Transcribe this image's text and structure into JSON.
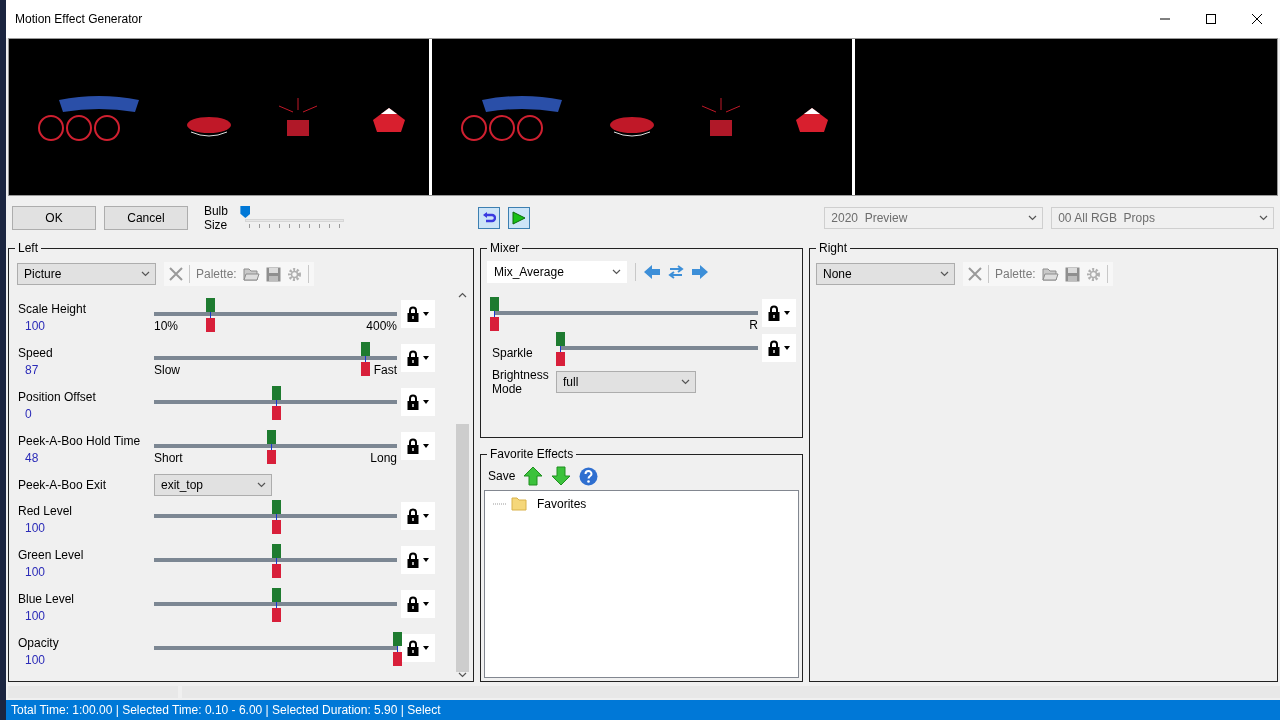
{
  "window": {
    "title": "Motion Effect Generator"
  },
  "preview": {
    "frames": [
      {
        "kind": "props"
      },
      {
        "kind": "props"
      },
      {
        "kind": "empty"
      }
    ]
  },
  "toolbar": {
    "ok": "OK",
    "cancel": "Cancel",
    "bulb_size": {
      "label": "Bulb Size",
      "level": 0
    },
    "preview_dropdown": {
      "value": "2020  Preview",
      "disabled": true
    },
    "props_dropdown": {
      "value": "00 All RGB  Props",
      "disabled": true
    }
  },
  "left": {
    "title": "Left",
    "effect": "Picture",
    "palette_label": "Palette:",
    "rows": [
      {
        "kind": "slider",
        "label": "Scale Height",
        "value": "100",
        "level": 0.23,
        "min_label": "10%",
        "max_label": "400%"
      },
      {
        "kind": "slider",
        "label": "Speed",
        "value": "87",
        "level": 0.87,
        "min_label": "Slow",
        "max_label": "Fast"
      },
      {
        "kind": "slider",
        "label": "Position Offset",
        "value": "0",
        "level": 0.5
      },
      {
        "kind": "slider",
        "label": "Peek-A-Boo Hold Time",
        "value": "48",
        "level": 0.48,
        "min_label": "Short",
        "max_label": "Long"
      },
      {
        "kind": "dropdown",
        "label": "Peek-A-Boo Exit",
        "value": "exit_top"
      },
      {
        "kind": "slider",
        "label": "Red Level",
        "value": "100",
        "level": 0.5
      },
      {
        "kind": "slider",
        "label": "Green Level",
        "value": "100",
        "level": 0.5
      },
      {
        "kind": "slider",
        "label": "Blue Level",
        "value": "100",
        "level": 0.5
      },
      {
        "kind": "slider",
        "label": "Opacity",
        "value": "100",
        "level": 1.0
      }
    ]
  },
  "mixer": {
    "title": "Mixer",
    "mode": "Mix_Average",
    "blend": {
      "level": 0,
      "end_label": "R"
    },
    "sparkle": {
      "label": "Sparkle",
      "level": 0
    },
    "brightness": {
      "label": "Brightness Mode",
      "value": "full"
    }
  },
  "favorites": {
    "title": "Favorite Effects",
    "save": "Save",
    "tree": [
      {
        "label": "Favorites"
      }
    ]
  },
  "right": {
    "title": "Right",
    "effect": "None",
    "palette_label": "Palette:"
  },
  "status_bar": "Total Time: 1:00.00 | Selected Time: 0.10 - 6.00 | Selected Duration: 5.90 | Select"
}
